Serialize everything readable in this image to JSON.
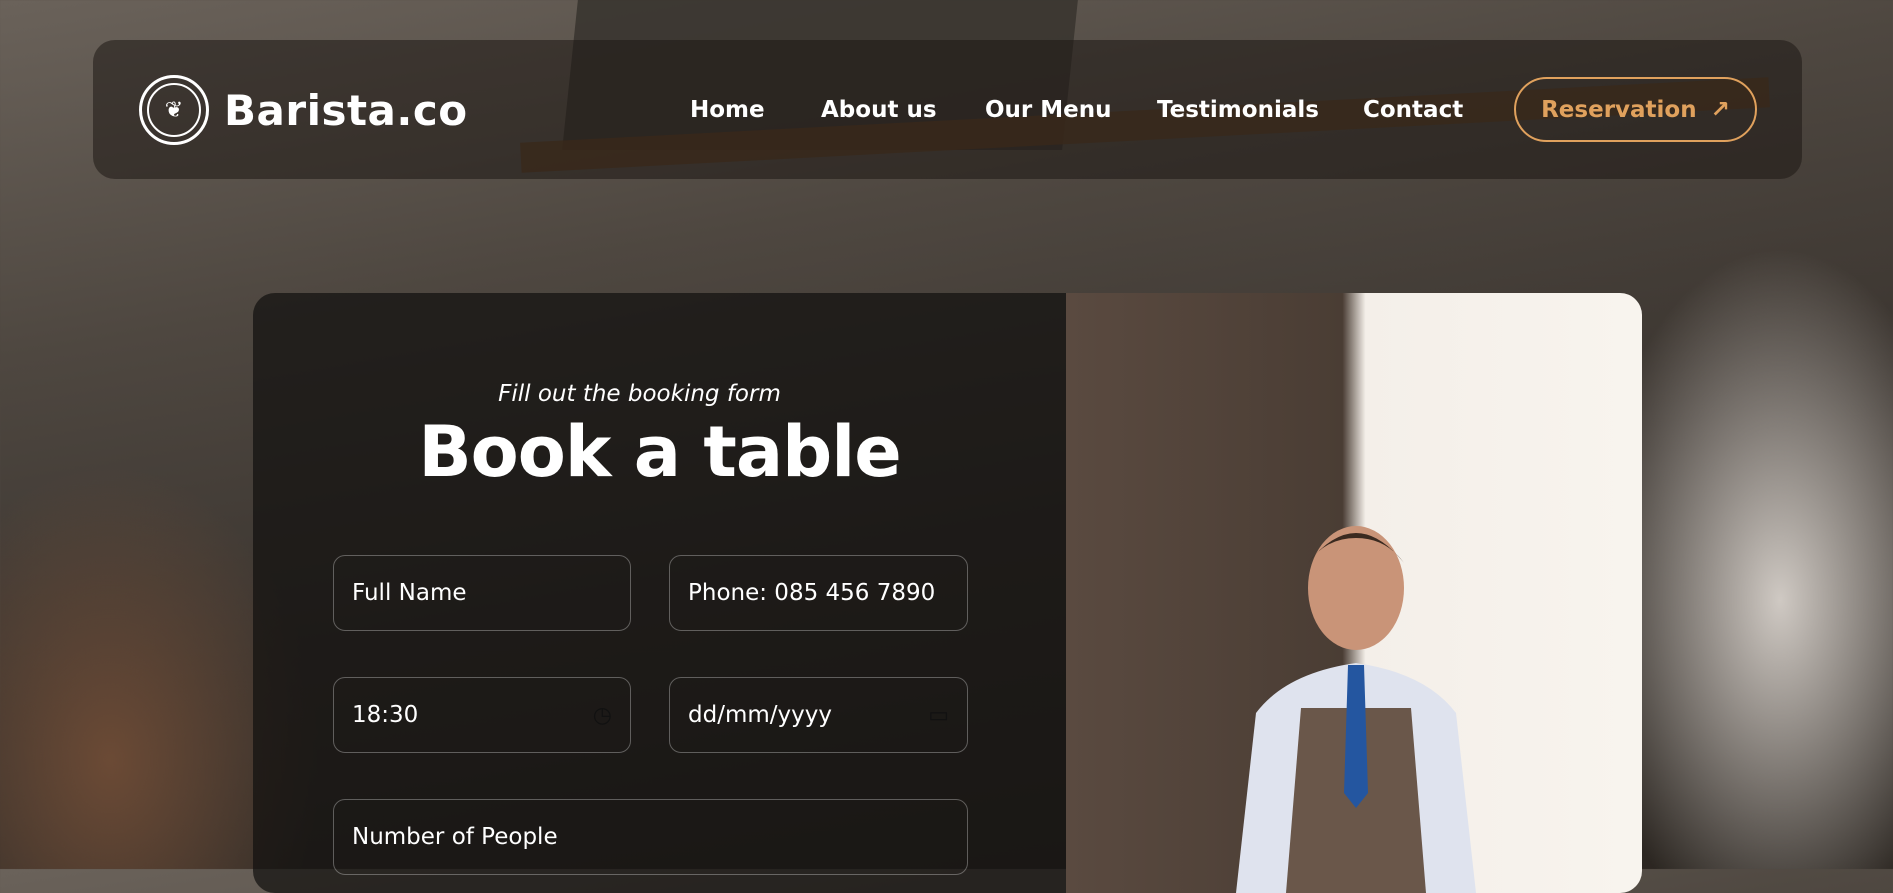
{
  "nav": {
    "brand": "Barista.co",
    "links": [
      "Home",
      "About us",
      "Our Menu",
      "Testimonials",
      "Contact"
    ],
    "reservation_label": "Reservation",
    "reservation_icon": "arrow-up-right-icon"
  },
  "booking": {
    "subtitle": "Fill out the booking form",
    "title": "Book a table",
    "fields": {
      "full_name": "Full Name",
      "phone": "Phone: 085 456 7890",
      "time": "18:30",
      "date": "dd/mm/yyyy",
      "people": "Number of People"
    }
  },
  "colors": {
    "accent": "#e0a15d"
  }
}
